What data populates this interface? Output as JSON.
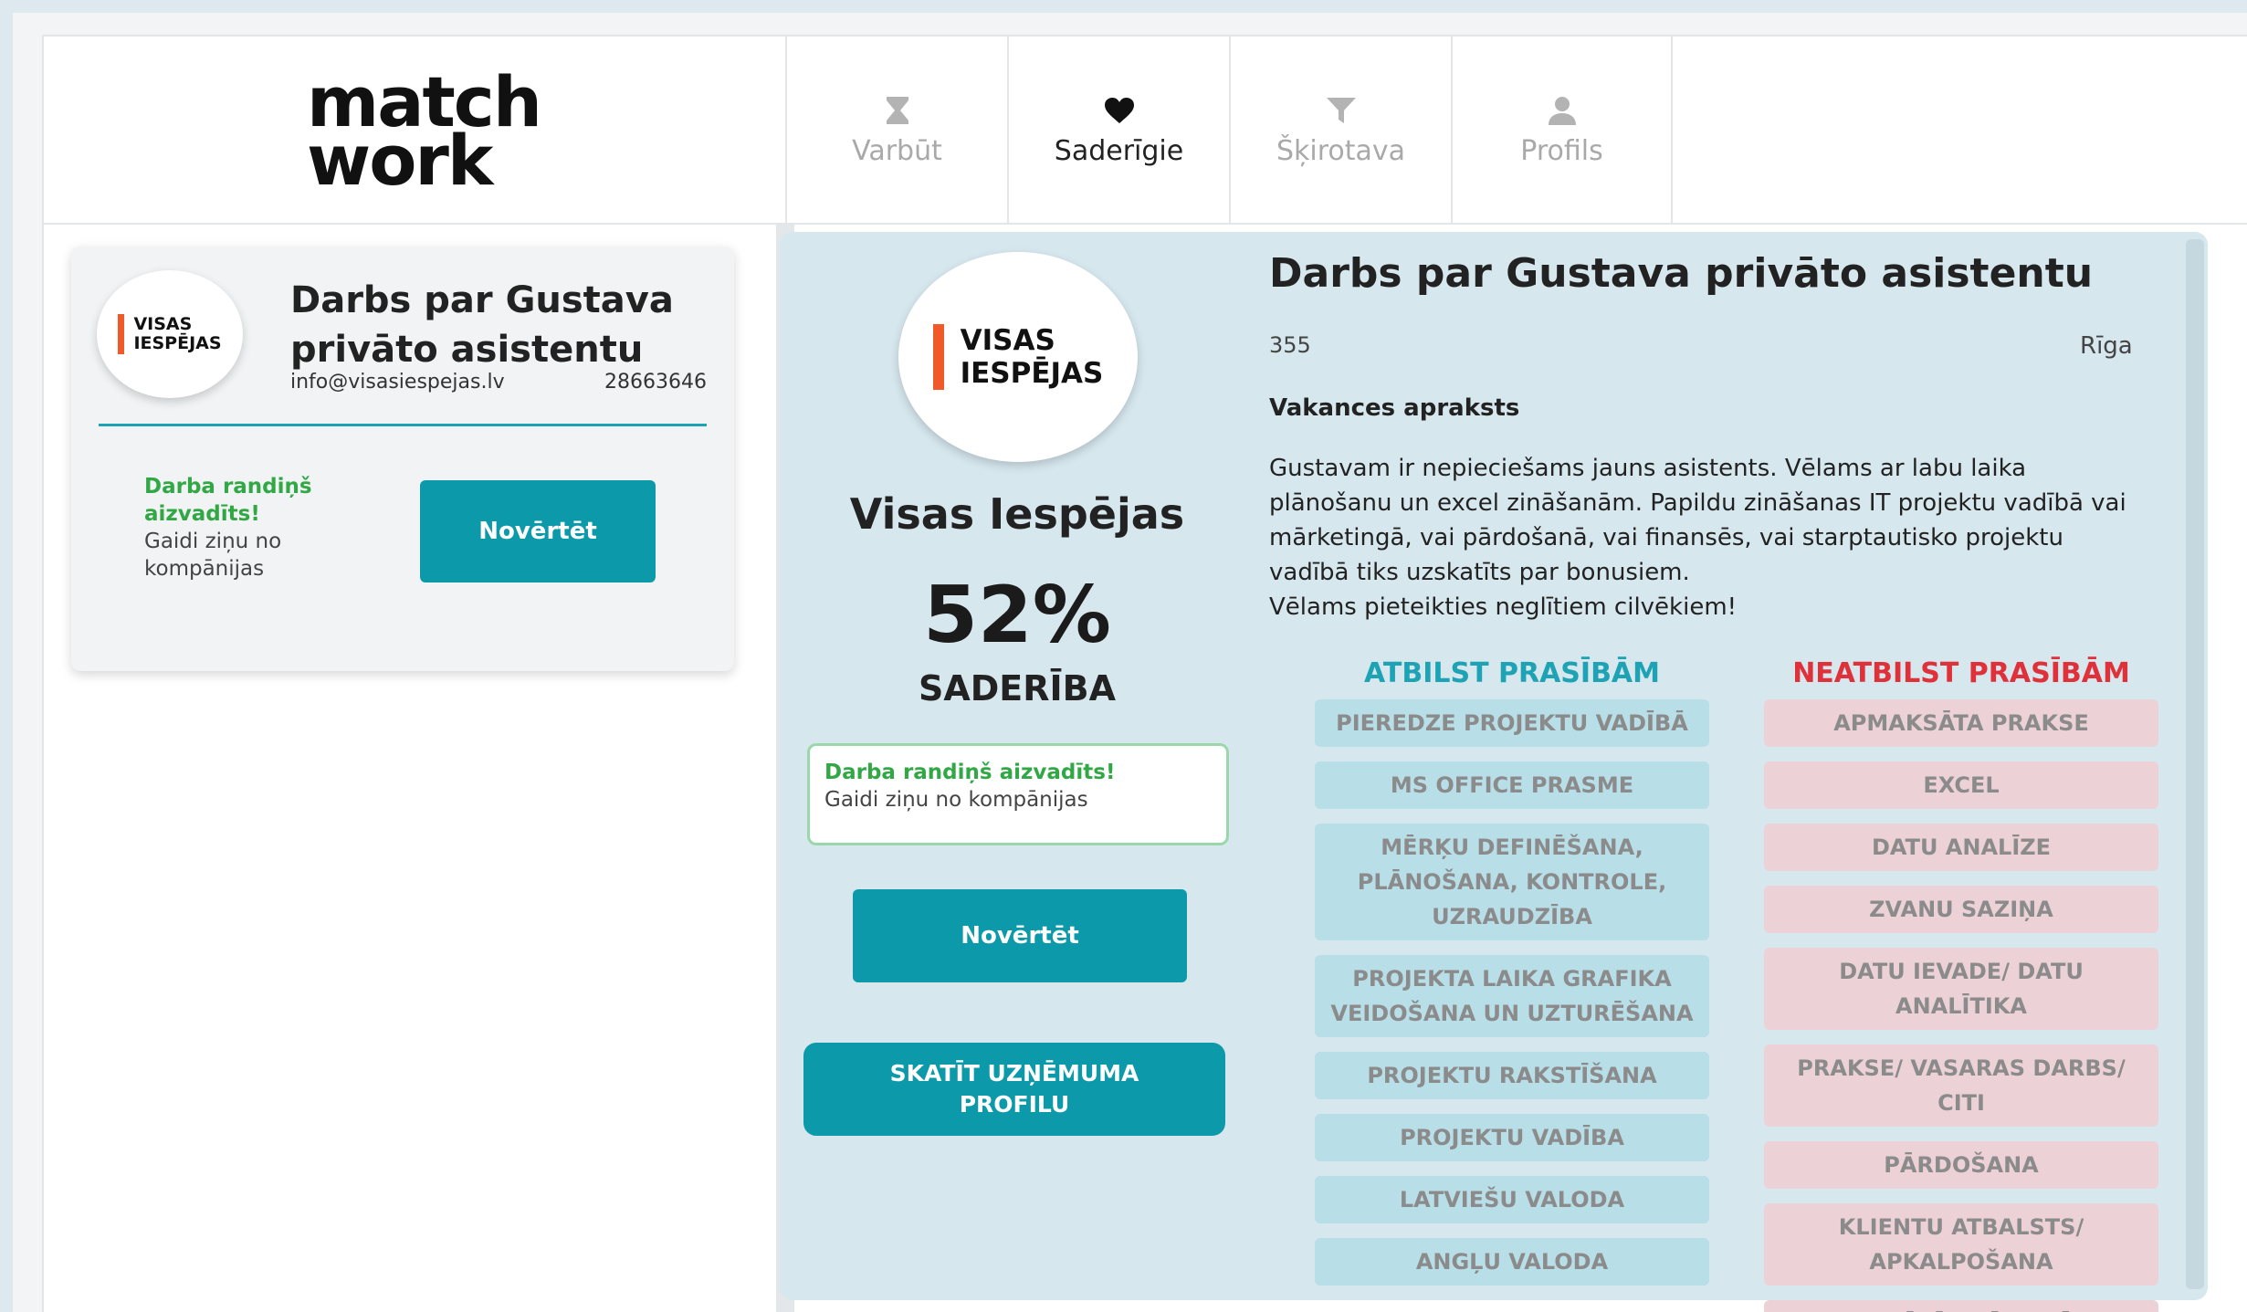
{
  "logo": {
    "line1": "match",
    "line2": "work"
  },
  "nav": [
    {
      "label": "Varbūt",
      "icon": "hourglass-icon",
      "active": false
    },
    {
      "label": "Saderīgie",
      "icon": "heart-icon",
      "active": true
    },
    {
      "label": "Šķirotava",
      "icon": "funnel-icon",
      "active": false
    },
    {
      "label": "Profils",
      "icon": "user-icon",
      "active": false
    }
  ],
  "card": {
    "company_logo": {
      "line1": "VISAS",
      "line2": "IESPĒJAS"
    },
    "title": "Darbs par Gustava privāto asistentu",
    "email": "info@visasiespejas.lv",
    "phone": "28663646",
    "status_line1": "Darba randiņš aizvadīts!",
    "status_line2": "Gaidi ziņu no kompānijas",
    "rate_button": "Novērtēt"
  },
  "detail": {
    "company_logo": {
      "line1": "VISAS",
      "line2": "IESPĒJAS"
    },
    "company_name": "Visas Iespējas",
    "match_percent": "52%",
    "match_label": "SADERĪBA",
    "status_line1": "Darba randiņš aizvadīts!",
    "status_line2": "Gaidi ziņu no kompānijas",
    "rate_button": "Novērtēt",
    "profile_button": "SKATĪT UZŅĒMUMA PROFILU",
    "job_title": "Darbs par Gustava privāto asistentu",
    "job_number": "355",
    "location": "Rīga",
    "description_heading": "Vakances apraksts",
    "description": "Gustavam ir nepieciešams jauns asistents. Vēlams ar labu laika plānošanu un excel zināšanām. Papildu zināšanas IT projektu vadībā vai mārketingā, vai pārdošanā, vai finansēs, vai starptautisko projektu vadībā tiks uzskatīts par bonusiem.",
    "description_line2": "Vēlams pieteikties neglītiem cilvēkiem!",
    "matching_heading": "ATBILST PRASĪBĀM",
    "matching": [
      "PIEREDZE PROJEKTU VADĪBĀ",
      "MS OFFICE PRASME",
      "MĒRĶU DEFINĒŠANA, PLĀNOŠANA, KONTROLE, UZRAUDZĪBA",
      "PROJEKTA LAIKA GRAFIKA VEIDOŠANA UN UZTURĒŠANA",
      "PROJEKTU RAKSTĪŠANA",
      "PROJEKTU VADĪBA",
      "LATVIEŠU VALODA",
      "ANGĻU VALODA"
    ],
    "nonmatching_heading": "NEATBILST PRASĪBĀM",
    "nonmatching": [
      "APMAKSĀTA PRAKSE",
      "EXCEL",
      "DATU ANALĪZE",
      "ZVANU SAZIŅA",
      "DATU IEVADE/ DATU ANALĪTIKA",
      "PRAKSE/ VASARAS DARBS/ CITI",
      "PĀRDOŠANA",
      "KLIENTU ATBALSTS/ APKALPOŠANA",
      "PILNĪBĀ KLĀTIENĒ"
    ]
  },
  "colors": {
    "accent": "#0c9aaa",
    "match_bg": "#b8dee8",
    "nonmatch_bg": "#ecd2d6",
    "panel_bg": "#d6e7ee",
    "success": "#31a845",
    "danger": "#e0303a"
  }
}
